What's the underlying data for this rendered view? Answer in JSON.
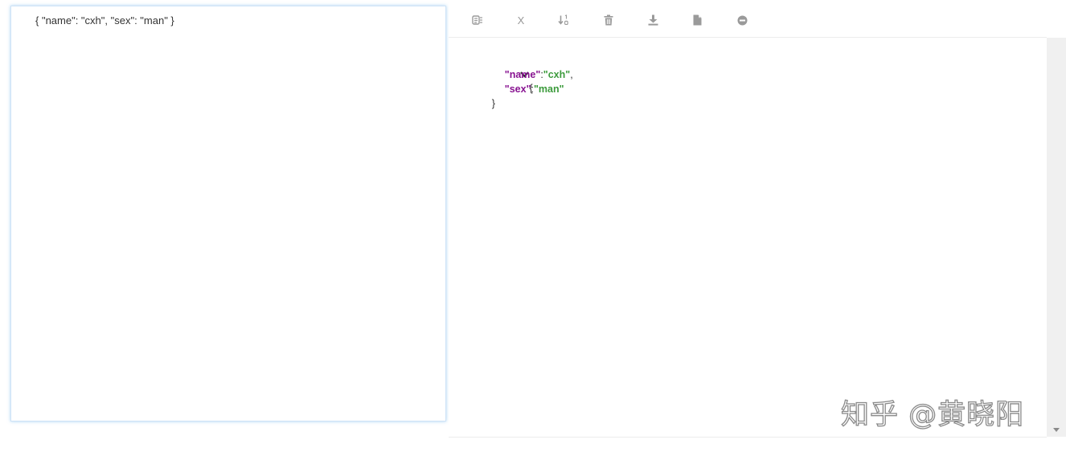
{
  "input": {
    "value": "{ \"name\": \"cxh\", \"sex\": \"man\" }"
  },
  "toolbar": {
    "buttons": [
      {
        "name": "format-icon"
      },
      {
        "name": "x-icon",
        "label": "X"
      },
      {
        "name": "sort-icon"
      },
      {
        "name": "trash-icon"
      },
      {
        "name": "download-icon"
      },
      {
        "name": "file-icon"
      },
      {
        "name": "minus-circle-icon"
      }
    ]
  },
  "viewer": {
    "open_brace": "{",
    "close_brace": "}",
    "entries": [
      {
        "key": "\"name\"",
        "value": "\"cxh\"",
        "trailing": ","
      },
      {
        "key": "\"sex\"",
        "value": "\"man\"",
        "trailing": ""
      }
    ],
    "colon": ":"
  },
  "watermark": {
    "text": "知乎 @黄晓阳"
  },
  "colors": {
    "key": "#881391",
    "string": "#3c9b3c",
    "focus_border": "#66afe9"
  }
}
